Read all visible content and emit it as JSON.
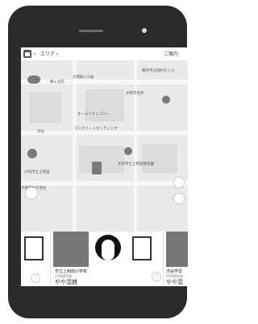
{
  "device": {
    "body_color": "#2b2b2b"
  },
  "app": {
    "topbar": {
      "area_label": "エリア",
      "right_label": "ご案内",
      "home_icon": "home-icon"
    },
    "map": {
      "labels": [
        "大和駅+三角",
        "大和市役所",
        "オールドヒッコリー",
        "コンクリートカッティング",
        "大和市立上和田",
        "大和市立上和田保育園",
        "渋谷",
        "桐ヶ丘町",
        "横浜市立岡村さくら",
        "大和市立引地台"
      ],
      "pins": [
        "closed-pin",
        "info-pin",
        "toilet-pin",
        "shop-pin"
      ],
      "fabs": [
        "list-icon",
        "locate-arrow-icon",
        "user-icon"
      ]
    },
    "cards": [
      {
        "title": "",
        "subtitle": "",
        "status": ""
      },
      {
        "title": "市立上和田小学校",
        "subtitle": "24時間営業",
        "status": "やや混雑"
      },
      {
        "title": "渋谷学習",
        "subtitle": "24時間営業",
        "status": "やや混"
      }
    ],
    "colors": {
      "accent": "#555555",
      "pin": "#7a7a7a"
    }
  }
}
